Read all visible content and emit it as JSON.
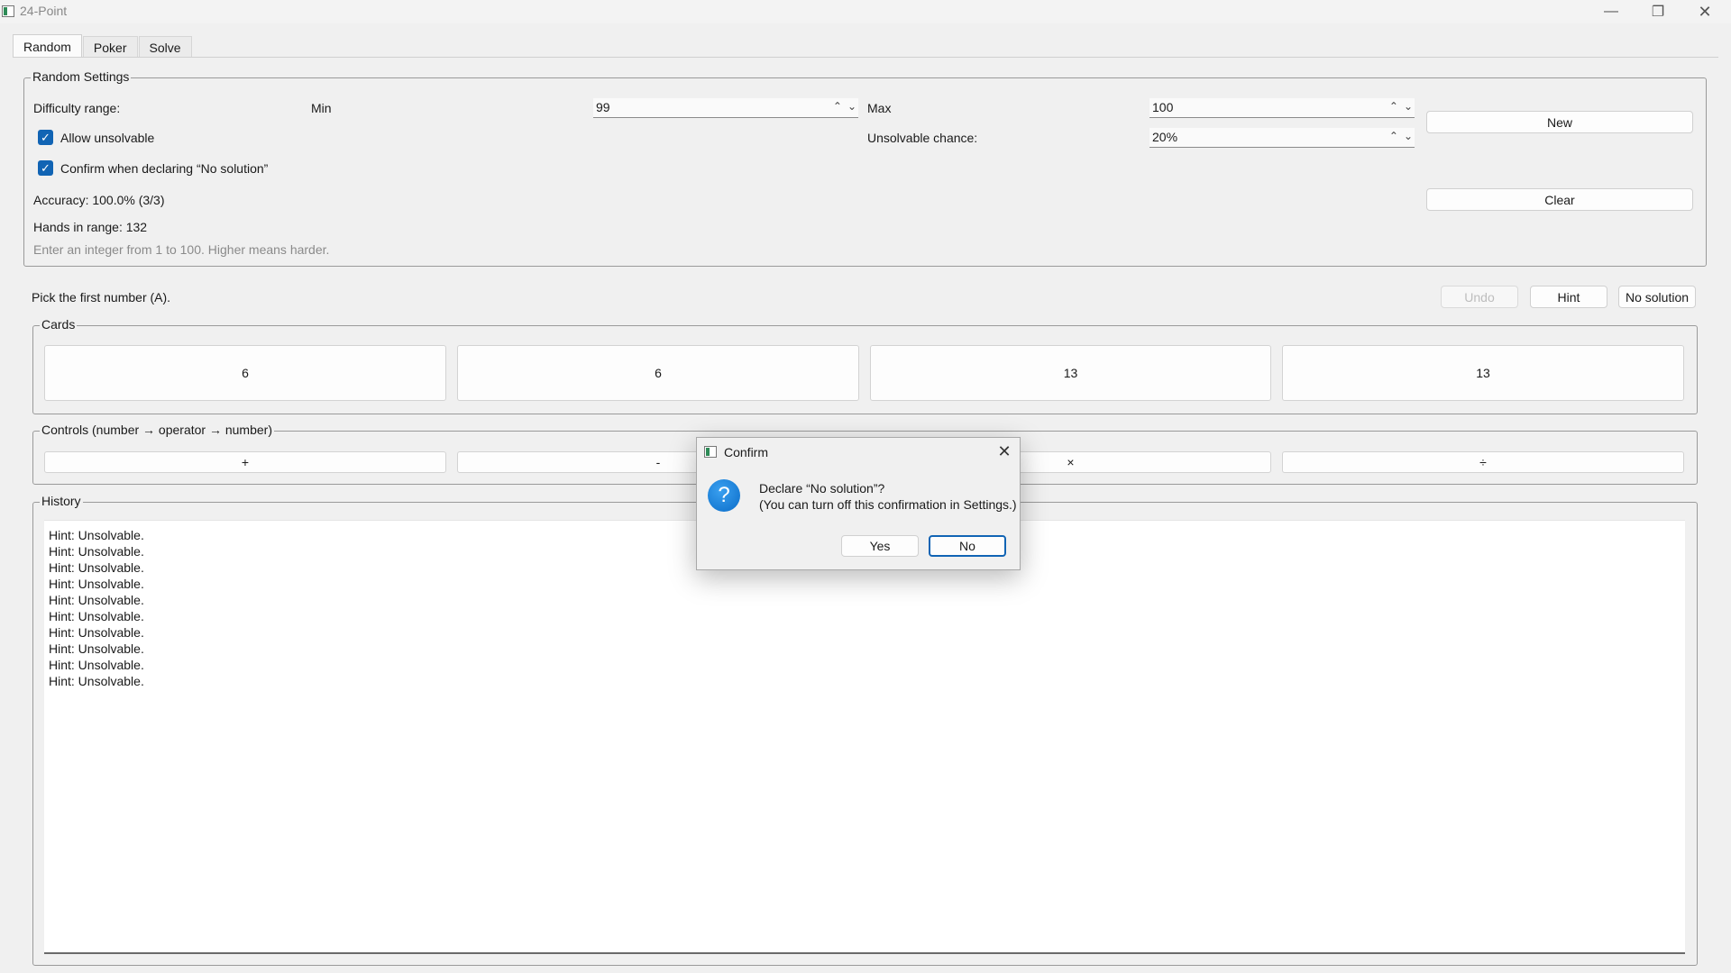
{
  "window": {
    "title": "24-Point",
    "minimize": "—",
    "restore": "❐",
    "close": "✕"
  },
  "tabs": [
    {
      "label": "Random",
      "active": true
    },
    {
      "label": "Poker",
      "active": false
    },
    {
      "label": "Solve",
      "active": false
    }
  ],
  "random_settings": {
    "group_title": "Random Settings",
    "difficulty_label": "Difficulty range:",
    "min_label": "Min",
    "min_value": "99",
    "max_label": "Max",
    "max_value": "100",
    "allow_unsolvable_label": "Allow unsolvable",
    "allow_unsolvable_checked": true,
    "confirm_label": "Confirm when declaring “No solution”",
    "confirm_checked": true,
    "unsolvable_chance_label": "Unsolvable chance:",
    "unsolvable_chance_value": "20%",
    "new_button": "New",
    "clear_button": "Clear",
    "accuracy": "Accuracy: 100.0% (3/3)",
    "hands_in_range": "Hands in range: 132",
    "hint_text": "Enter an integer from 1 to 100. Higher means harder."
  },
  "prompt": "Pick the first number (A).",
  "action_buttons": {
    "undo": "Undo",
    "hint": "Hint",
    "no_solution": "No solution"
  },
  "cards": {
    "group_title": "Cards",
    "values": [
      "6",
      "6",
      "13",
      "13"
    ]
  },
  "controls": {
    "group_title": "Controls (number → operator → number)",
    "operators": [
      "+",
      "-",
      "×",
      "÷"
    ]
  },
  "history": {
    "group_title": "History",
    "lines": [
      "Hint: Unsolvable.",
      "Hint: Unsolvable.",
      "Hint: Unsolvable.",
      "Hint: Unsolvable.",
      "Hint: Unsolvable.",
      "Hint: Unsolvable.",
      "Hint: Unsolvable.",
      "Hint: Unsolvable.",
      "Hint: Unsolvable.",
      "Hint: Unsolvable."
    ]
  },
  "dialog": {
    "title": "Confirm",
    "close": "✕",
    "icon": "question-icon",
    "icon_glyph": "?",
    "message_line1": "Declare “No solution”?",
    "message_line2": "(You can turn off this confirmation in Settings.)",
    "yes_button": "Yes",
    "no_button": "No"
  },
  "colors": {
    "accent": "#1164b4",
    "window_bg": "#f0f0f0"
  }
}
